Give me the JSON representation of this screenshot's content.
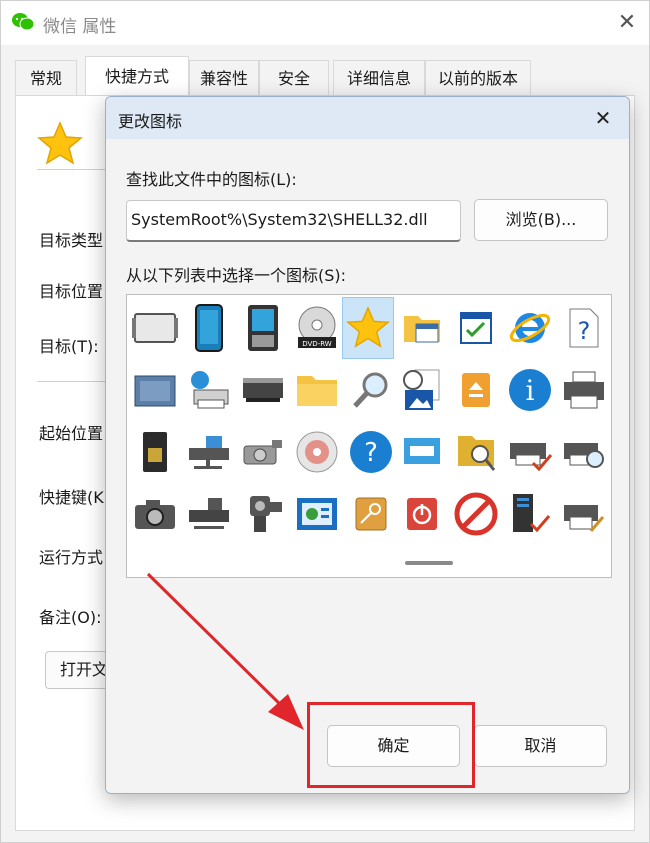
{
  "properties_window": {
    "title": "微信 属性",
    "tabs": [
      "常规",
      "快捷方式",
      "兼容性",
      "安全",
      "详细信息",
      "以前的版本"
    ],
    "active_tab": "快捷方式",
    "fields": {
      "target_type": "目标类型",
      "target_location": "目标位置",
      "target": "目标(T):",
      "start_in": "起始位置",
      "shortcut_key": "快捷键(K",
      "run": "运行方式",
      "comment": "备注(O):"
    },
    "open_file_location_button": "打开文"
  },
  "dialog": {
    "title": "更改图标",
    "lookup_label": "查找此文件中的图标(L):",
    "path_value": "SystemRoot%\\System32\\SHELL32.dll",
    "browse_button": "浏览(B)...",
    "choose_label": "从以下列表中选择一个图标(S):",
    "ok_button": "确定",
    "cancel_button": "取消",
    "icons": [
      "blank-display-icon",
      "tablet-icon",
      "handheld-device-icon",
      "dvd-rw-icon",
      "star-icon",
      "folder-calendar-icon",
      "checklist-window-icon",
      "internet-explorer-icon",
      "help-document-icon",
      "memory-chip-icon",
      "network-printer-icon",
      "scanner-icon",
      "folder-icon",
      "magnifier-icon",
      "document-picture-icon",
      "orange-drive-icon",
      "info-icon",
      "printer-icon",
      "sd-card-icon",
      "network-drive-icon",
      "projector-icon",
      "cd-audio-icon",
      "help-circle-icon",
      "window-panel-icon",
      "folder-search-icon",
      "printer-check-icon",
      "printer-search-icon",
      "camera-icon",
      "drive-stack-icon",
      "webcam-icon",
      "control-panel-icon",
      "key-icon",
      "power-icon",
      "prohibited-icon",
      "server-check-icon",
      "printer-edit-icon"
    ],
    "selected_icon_index": 4,
    "dvd_label": "DVD-RW"
  },
  "annotation": {
    "color": "#e0262b"
  }
}
